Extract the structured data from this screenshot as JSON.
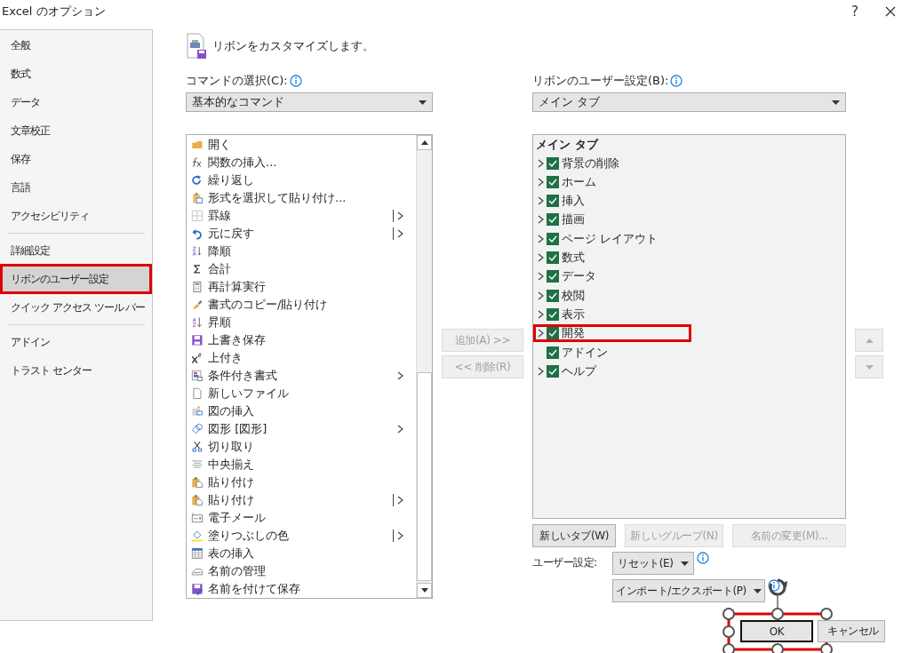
{
  "window": {
    "title": "Excel のオプション",
    "help": "?"
  },
  "sidebar": {
    "sections": [
      {
        "items": [
          {
            "label": "全般",
            "selected": false,
            "highlighted": false
          },
          {
            "label": "数式",
            "selected": false,
            "highlighted": false
          },
          {
            "label": "データ",
            "selected": false,
            "highlighted": false
          },
          {
            "label": "文章校正",
            "selected": false,
            "highlighted": false
          },
          {
            "label": "保存",
            "selected": false,
            "highlighted": false
          },
          {
            "label": "言語",
            "selected": false,
            "highlighted": false
          },
          {
            "label": "アクセシビリティ",
            "selected": false,
            "highlighted": false
          }
        ]
      },
      {
        "items": [
          {
            "label": "詳細設定",
            "selected": false,
            "highlighted": false
          },
          {
            "label": "リボンのユーザー設定",
            "selected": true,
            "highlighted": true
          },
          {
            "label": "クイック アクセス ツール バー",
            "selected": false,
            "highlighted": false
          }
        ]
      },
      {
        "items": [
          {
            "label": "アドイン",
            "selected": false,
            "highlighted": false
          },
          {
            "label": "トラスト センター",
            "selected": false,
            "highlighted": false
          }
        ]
      }
    ]
  },
  "header": {
    "text": "リボンをカスタマイズします。"
  },
  "commands": {
    "label": "コマンドの選択(C):",
    "dropdown": "基本的なコマンド",
    "items": [
      {
        "label": "開く",
        "kind": "plain"
      },
      {
        "label": "関数の挿入...",
        "kind": "plain"
      },
      {
        "label": "繰り返し",
        "kind": "plain"
      },
      {
        "label": "形式を選択して貼り付け...",
        "kind": "plain"
      },
      {
        "label": "罫線",
        "kind": "split"
      },
      {
        "label": "元に戻す",
        "kind": "split"
      },
      {
        "label": "降順",
        "kind": "plain"
      },
      {
        "label": "合計",
        "kind": "plain"
      },
      {
        "label": "再計算実行",
        "kind": "plain"
      },
      {
        "label": "書式のコピー/貼り付け",
        "kind": "plain"
      },
      {
        "label": "昇順",
        "kind": "plain"
      },
      {
        "label": "上書き保存",
        "kind": "plain"
      },
      {
        "label": "上付き",
        "kind": "plain"
      },
      {
        "label": "条件付き書式",
        "kind": "submenu"
      },
      {
        "label": "新しいファイル",
        "kind": "plain"
      },
      {
        "label": "図の挿入",
        "kind": "plain"
      },
      {
        "label": "図形 [図形]",
        "kind": "submenu"
      },
      {
        "label": "切り取り",
        "kind": "plain"
      },
      {
        "label": "中央揃え",
        "kind": "plain"
      },
      {
        "label": "貼り付け",
        "kind": "plain"
      },
      {
        "label": "貼り付け",
        "kind": "split"
      },
      {
        "label": "電子メール",
        "kind": "plain"
      },
      {
        "label": "塗りつぶしの色",
        "kind": "split"
      },
      {
        "label": "表の挿入",
        "kind": "plain"
      },
      {
        "label": "名前の管理",
        "kind": "plain"
      },
      {
        "label": "名前を付けて保存",
        "kind": "plain"
      }
    ]
  },
  "transfer_buttons": [
    {
      "label": "追加(A) >>",
      "disabled": true
    },
    {
      "label": "<< 削除(R)",
      "disabled": true
    }
  ],
  "ribbon": {
    "label": "リボンのユーザー設定(B):",
    "dropdown": "メイン タブ",
    "tree_title": "メイン タブ",
    "tabs": [
      {
        "label": "背景の削除",
        "expandable": true,
        "checked": true,
        "highlighted": false
      },
      {
        "label": "ホーム",
        "expandable": true,
        "checked": true,
        "highlighted": false
      },
      {
        "label": "挿入",
        "expandable": true,
        "checked": true,
        "highlighted": false
      },
      {
        "label": "描画",
        "expandable": true,
        "checked": true,
        "highlighted": false
      },
      {
        "label": "ページ レイアウト",
        "expandable": true,
        "checked": true,
        "highlighted": false
      },
      {
        "label": "数式",
        "expandable": true,
        "checked": true,
        "highlighted": false
      },
      {
        "label": "データ",
        "expandable": true,
        "checked": true,
        "highlighted": false
      },
      {
        "label": "校閲",
        "expandable": true,
        "checked": true,
        "highlighted": false
      },
      {
        "label": "表示",
        "expandable": true,
        "checked": true,
        "highlighted": false
      },
      {
        "label": "開発",
        "expandable": true,
        "checked": true,
        "highlighted": true
      },
      {
        "label": "アドイン",
        "expandable": false,
        "checked": true,
        "highlighted": false
      },
      {
        "label": "ヘルプ",
        "expandable": true,
        "checked": true,
        "highlighted": false
      }
    ]
  },
  "move_buttons": [
    {
      "kind": "up",
      "disabled": true
    },
    {
      "kind": "down",
      "disabled": true
    }
  ],
  "tree_buttons": [
    {
      "label": "新しいタブ(W)",
      "disabled": false
    },
    {
      "label": "新しいグループ(N)",
      "disabled": true
    },
    {
      "label": "名前の変更(M)...",
      "disabled": true
    }
  ],
  "customizations": {
    "label": "ユーザー設定:",
    "reset": "リセット(E)",
    "import_export": "インポート/エクスポート(P)"
  },
  "dialog_buttons": [
    {
      "label": "OK",
      "default": true,
      "highlighted": true
    },
    {
      "label": "キャンセル",
      "default": false,
      "highlighted": false
    }
  ]
}
